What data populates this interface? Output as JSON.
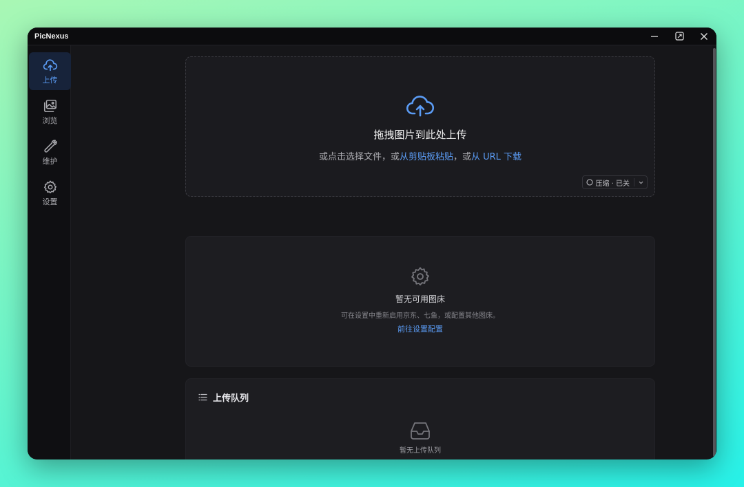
{
  "window": {
    "title": "PicNexus"
  },
  "sidebar": {
    "items": [
      {
        "label": "上传",
        "icon": "cloud-upload-icon",
        "active": true
      },
      {
        "label": "浏览",
        "icon": "images-icon",
        "active": false
      },
      {
        "label": "维护",
        "icon": "wrench-icon",
        "active": false
      },
      {
        "label": "设置",
        "icon": "gear-icon",
        "active": false
      }
    ]
  },
  "dropzone": {
    "title": "拖拽图片到此处上传",
    "subtitle_prefix": "或点击选择文件，或",
    "clipboard_link": "从剪贴板粘贴",
    "separator": "，或",
    "url_link": "从 URL 下载",
    "compress": {
      "label": "压缩 · 已关"
    }
  },
  "no_host": {
    "title": "暂无可用图床",
    "description": "可在设置中重新启用京东、七鱼，或配置其他图床。",
    "link": "前往设置配置"
  },
  "queue": {
    "title": "上传队列",
    "empty": "暂无上传队列"
  },
  "colors": {
    "accent": "#5b9cf5",
    "background": "#161619",
    "sidebar_active": "#17233a"
  }
}
